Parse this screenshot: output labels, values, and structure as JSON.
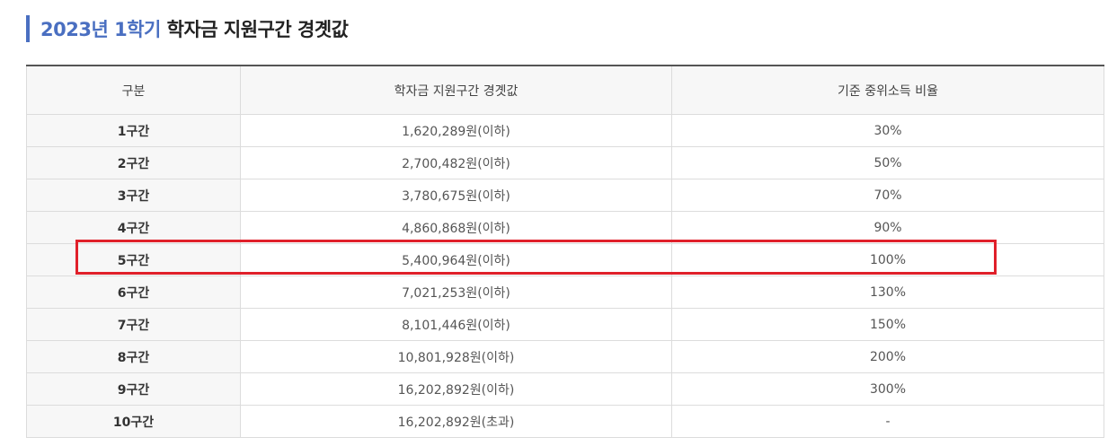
{
  "title": {
    "accent": "2023년 1학기",
    "rest": " 학자금 지원구간 경곗값"
  },
  "table": {
    "headers": [
      "구분",
      "학자금 지원구간 경곗값",
      "기준 중위소득 비율"
    ],
    "rows": [
      {
        "band": "1구간",
        "amount": "1,620,289원(이하)",
        "ratio": "30%"
      },
      {
        "band": "2구간",
        "amount": "2,700,482원(이하)",
        "ratio": "50%"
      },
      {
        "band": "3구간",
        "amount": "3,780,675원(이하)",
        "ratio": "70%"
      },
      {
        "band": "4구간",
        "amount": "4,860,868원(이하)",
        "ratio": "90%"
      },
      {
        "band": "5구간",
        "amount": "5,400,964원(이하)",
        "ratio": "100%"
      },
      {
        "band": "6구간",
        "amount": "7,021,253원(이하)",
        "ratio": "130%"
      },
      {
        "band": "7구간",
        "amount": "8,101,446원(이하)",
        "ratio": "150%"
      },
      {
        "band": "8구간",
        "amount": "10,801,928원(이하)",
        "ratio": "200%"
      },
      {
        "band": "9구간",
        "amount": "16,202,892원(이하)",
        "ratio": "300%"
      },
      {
        "band": "10구간",
        "amount": "16,202,892원(초과)",
        "ratio": "-"
      }
    ]
  },
  "colors": {
    "accent": "#4a6fc1",
    "highlight_border": "#e0202a",
    "header_bg": "#f7f7f7",
    "grid_line": "#dcdcdc"
  }
}
